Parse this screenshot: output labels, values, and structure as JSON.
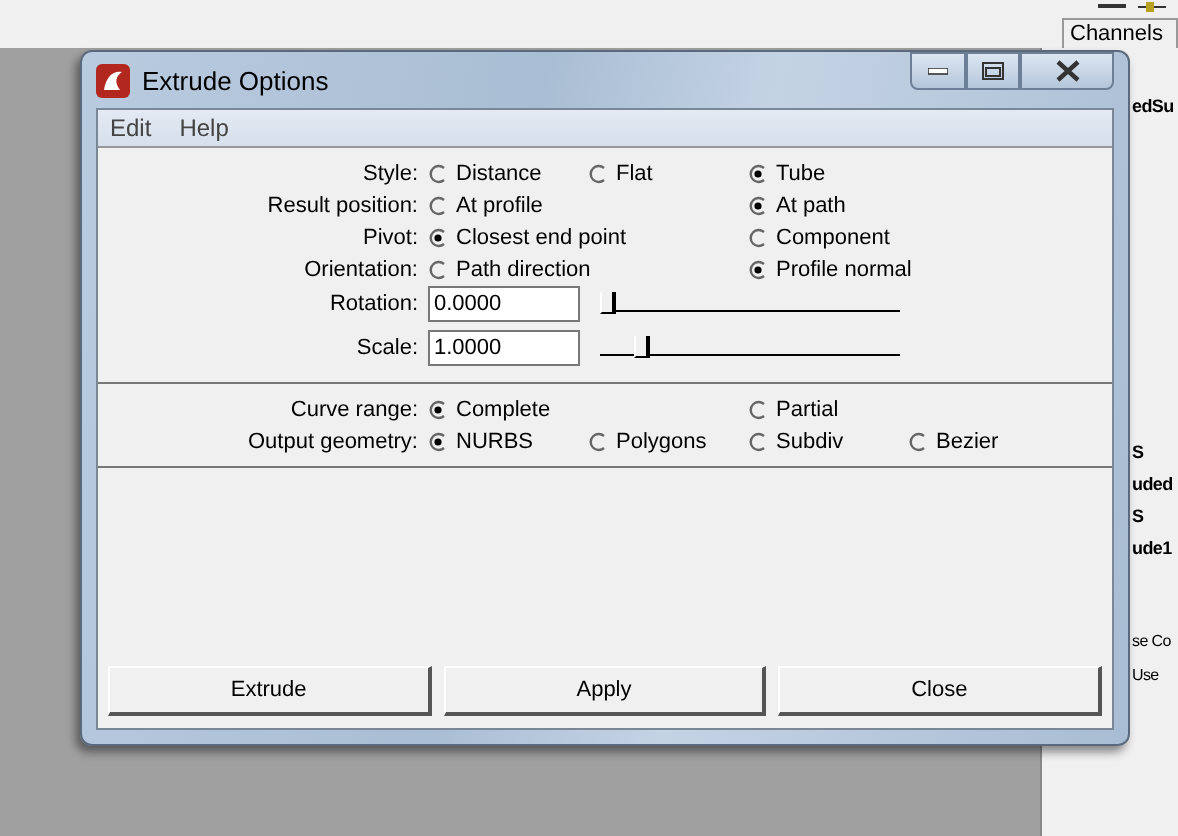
{
  "background": {
    "panel_title": "Channels",
    "panel_texts": [
      {
        "text": "edSu",
        "kind": "bold"
      },
      {
        "text": "S",
        "kind": "bold"
      },
      {
        "text": "uded",
        "kind": "bold"
      },
      {
        "text": "S",
        "kind": "bold"
      },
      {
        "text": "ude1",
        "kind": "bold"
      },
      {
        "text": "se Co",
        "kind": "plain"
      },
      {
        "text": "Use",
        "kind": "plain"
      }
    ]
  },
  "window": {
    "title": "Extrude Options"
  },
  "menu": [
    "Edit",
    "Help"
  ],
  "sections": [
    {
      "rows": [
        {
          "kind": "radio",
          "label": "Style:",
          "options": [
            {
              "label": "Distance",
              "selected": false
            },
            {
              "label": "Flat",
              "selected": false
            },
            {
              "label": "Tube",
              "selected": true
            }
          ]
        },
        {
          "kind": "radio",
          "label": "Result position:",
          "options": [
            {
              "label": "At profile",
              "selected": false
            },
            {
              "label": "At path",
              "selected": true
            }
          ]
        },
        {
          "kind": "radio",
          "label": "Pivot:",
          "options": [
            {
              "label": "Closest end point",
              "selected": true
            },
            {
              "label": "Component",
              "selected": false
            }
          ]
        },
        {
          "kind": "radio",
          "label": "Orientation:",
          "options": [
            {
              "label": "Path direction",
              "selected": false
            },
            {
              "label": "Profile normal",
              "selected": true
            }
          ]
        },
        {
          "kind": "slider",
          "label": "Rotation:",
          "value": "0.0000",
          "level": 0
        },
        {
          "kind": "slider",
          "label": "Scale:",
          "value": "1.0000",
          "level": 0.12
        }
      ]
    },
    {
      "rows": [
        {
          "kind": "radio",
          "label": "Curve range:",
          "options": [
            {
              "label": "Complete",
              "selected": true
            },
            {
              "label": "Partial",
              "selected": false
            }
          ]
        },
        {
          "kind": "radio",
          "label": "Output geometry:",
          "options": [
            {
              "label": "NURBS",
              "selected": true
            },
            {
              "label": "Polygons",
              "selected": false
            },
            {
              "label": "Subdiv",
              "selected": false
            },
            {
              "label": "Bezier",
              "selected": false
            }
          ]
        }
      ]
    }
  ],
  "buttons": [
    "Extrude",
    "Apply",
    "Close"
  ]
}
